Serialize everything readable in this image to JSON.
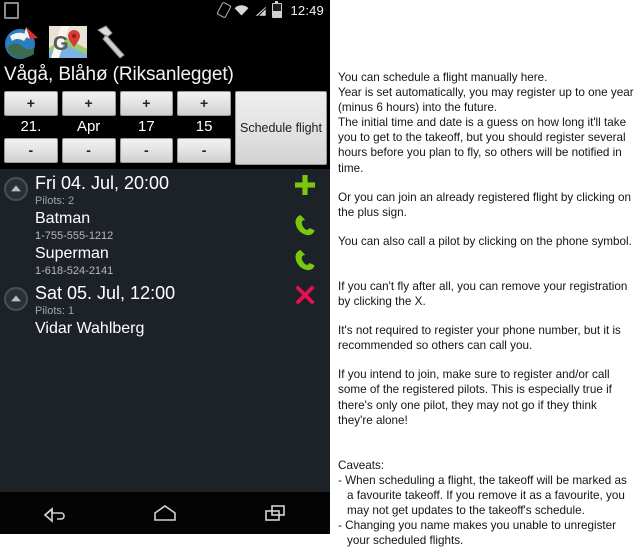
{
  "statusbar": {
    "time": "12:49",
    "icons": [
      "sim-card-icon",
      "rotation-lock-icon",
      "wifi-icon",
      "signal-bars-icon",
      "battery-icon"
    ]
  },
  "header": {
    "app_icons": [
      "paraglider-globe-icon",
      "google-maps-icon",
      "hammer-tools-icon"
    ],
    "takeoff_title": "Vågå, Blåhø (Riksanlegget)"
  },
  "scheduler": {
    "plus_label": "+",
    "minus_label": "-",
    "fields": [
      {
        "name": "day",
        "value": "21."
      },
      {
        "name": "month",
        "value": "Apr"
      },
      {
        "name": "hour",
        "value": "17"
      },
      {
        "name": "minute",
        "value": "15"
      }
    ],
    "schedule_button": "Schedule flight"
  },
  "flights": [
    {
      "date": "Fri 04. Jul, 20:00",
      "pilots_label": "Pilots: 2",
      "action": "add-me-icon",
      "pilots": [
        {
          "name": "Batman",
          "phone": "1-755-555-1212",
          "action": "call-icon"
        },
        {
          "name": "Superman",
          "phone": "1-618-524-2141",
          "action": "call-icon"
        }
      ]
    },
    {
      "date": "Sat 05. Jul, 12:00",
      "pilots_label": "Pilots: 1",
      "action": "remove-me-icon",
      "pilots": [
        {
          "name": "Vidar Wahlberg",
          "phone": "",
          "action": ""
        }
      ]
    }
  ],
  "navbar": {
    "back": "back-icon",
    "home": "home-icon",
    "recents": "recent-apps-icon"
  },
  "notes": {
    "p1": "You can schedule a flight manually here.\nYear is set automatically, you may register up to one year (minus 6 hours) into the future.\nThe initial time and date is a guess on how long it'll take you to get to the takeoff, but you should register several hours before you plan to fly, so others will be notified in time.",
    "p2": "Or you can join an already registered flight by clicking on the plus sign.",
    "p3": "You can also call a pilot by clicking on the phone symbol.",
    "p4": "If you can't fly after all, you can remove your registration by clicking the X.",
    "p5": "It's not required to register your phone number, but it is recommended so others can call you.",
    "p6": "If you intend to join, make sure to register and/or call some of the registered pilots. This is especially true if there's only one pilot, they may not go if they think they're alone!",
    "caveats_title": "Caveats:",
    "caveat1": "- When scheduling a flight, the takeoff will be marked as a favourite takeoff. If you remove it as a favourite, you may not get updates to the takeoff's schedule.",
    "caveat2": "- Changing you name makes you unable to unregister your scheduled flights."
  },
  "colors": {
    "accent_green": "#7ac70c",
    "accent_pink": "#ea0f51",
    "list_bg": "#1d2128",
    "button_face": "#e3e3e3"
  }
}
